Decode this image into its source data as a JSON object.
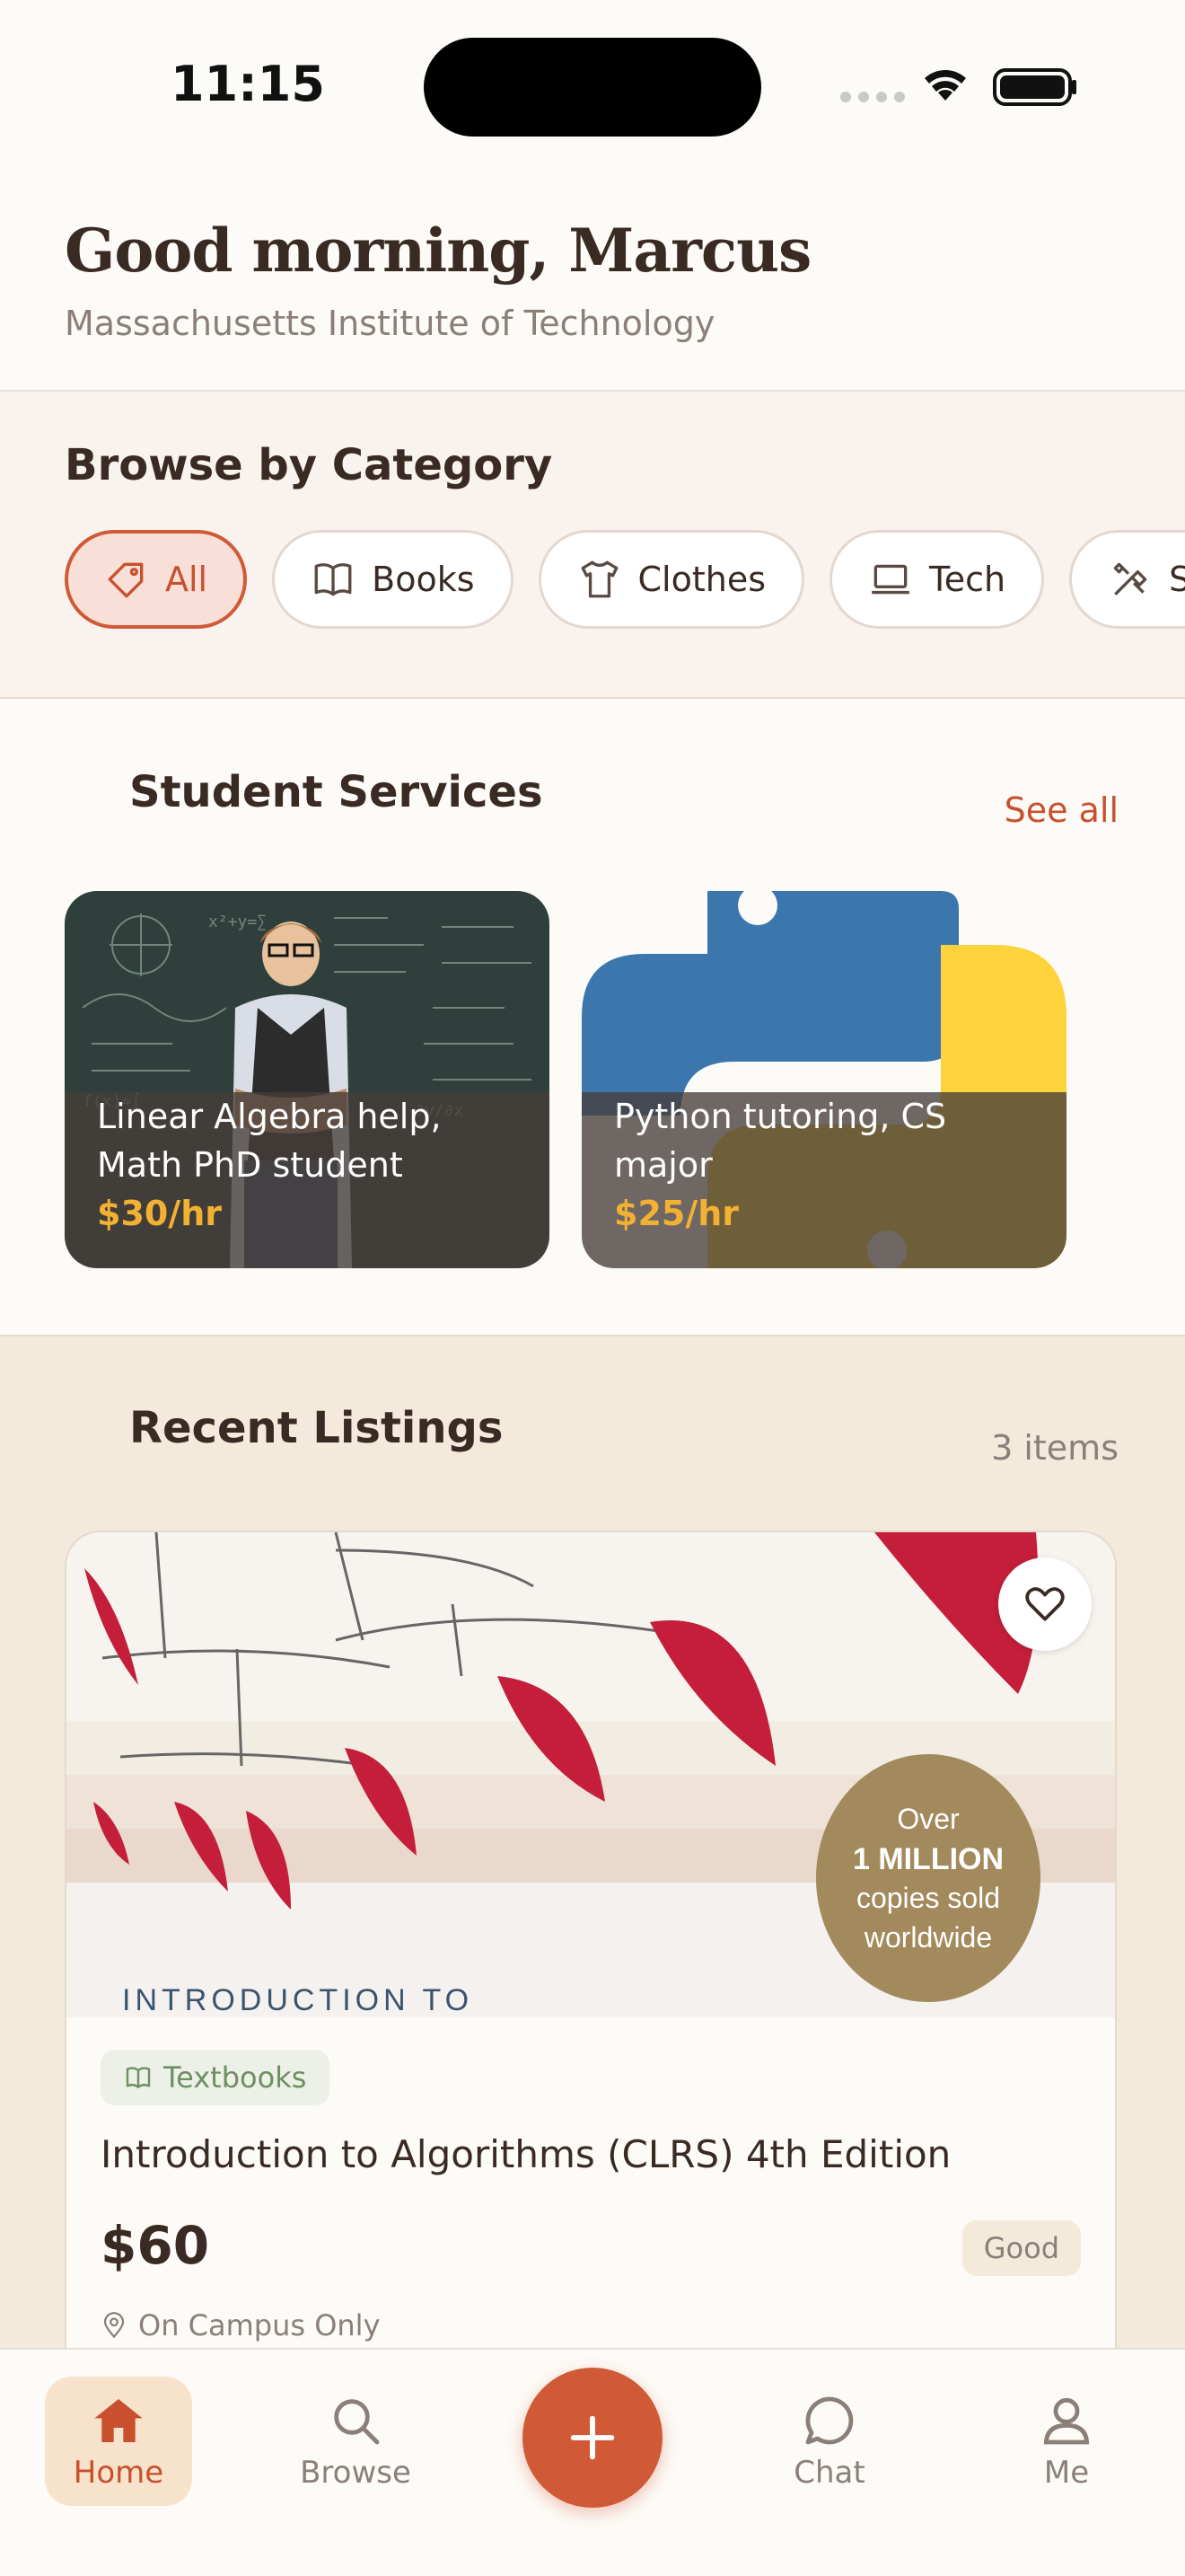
{
  "status_bar": {
    "time": "11:15"
  },
  "header": {
    "greeting": "Good morning, Marcus",
    "school": "Massachusetts Institute of Technology"
  },
  "categories": {
    "title": "Browse by Category",
    "chips": [
      {
        "label": "All",
        "icon": "tag-icon",
        "active": true
      },
      {
        "label": "Books",
        "icon": "book-icon"
      },
      {
        "label": "Clothes",
        "icon": "shirt-icon"
      },
      {
        "label": "Tech",
        "icon": "laptop-icon"
      },
      {
        "label": "Ser",
        "icon": "tools-icon"
      }
    ]
  },
  "services": {
    "title": "Student Services",
    "see_all": "See all",
    "cards": [
      {
        "title": "Linear Algebra help, Math PhD student",
        "price": "$30/hr"
      },
      {
        "title": "Python tutoring, CS major",
        "price": "$25/hr"
      }
    ]
  },
  "recent": {
    "title": "Recent Listings",
    "count": "3 items",
    "listing": {
      "cover_badge_lines": [
        "Over",
        "1 MILLION",
        "copies sold",
        "worldwide"
      ],
      "cover_text": "INTRODUCTION TO",
      "tag": "Textbooks",
      "title": "Introduction to Algorithms (CLRS) 4th Edition",
      "price": "$60",
      "condition": "Good",
      "location": "On Campus Only"
    }
  },
  "tabbar": {
    "home": "Home",
    "browse": "Browse",
    "chat": "Chat",
    "me": "Me"
  },
  "colors": {
    "accent": "#d05a36",
    "price_yellow": "#f2b133",
    "tag_green": "#6d8f62"
  }
}
